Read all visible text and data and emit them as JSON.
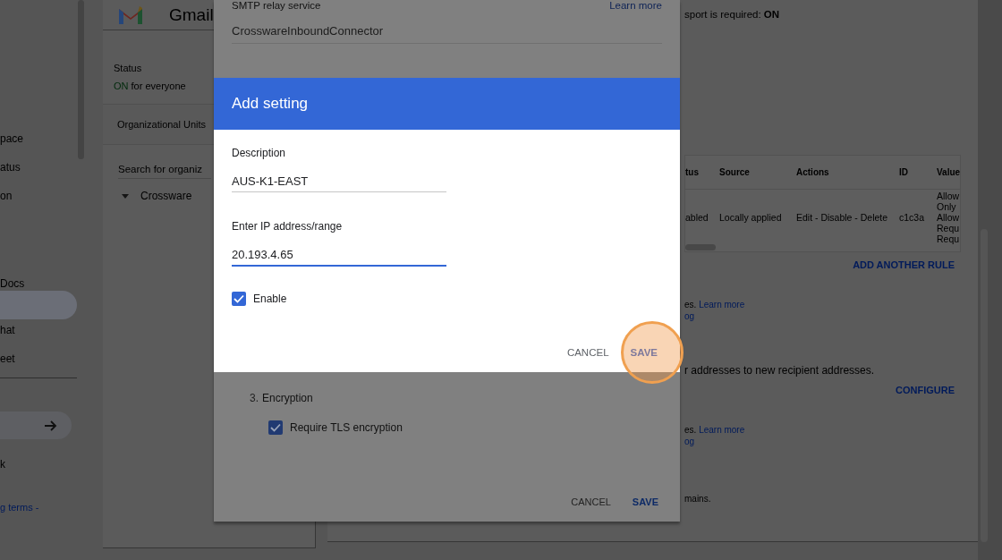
{
  "sidebar": {
    "groups": [
      {
        "items": [
          {
            "label": "pace",
            "selected": false
          },
          {
            "label": "atus",
            "selected": false
          },
          {
            "label": "on",
            "selected": false
          }
        ]
      },
      {
        "items": [
          {
            "label": "Docs",
            "selected": false
          },
          {
            "selected": true
          },
          {
            "label": "hat",
            "selected": false
          },
          {
            "label": "eet",
            "selected": false
          }
        ]
      }
    ],
    "after_divider": {
      "label": "k"
    },
    "footer_link": "g terms -"
  },
  "app_card": {
    "title": "Gmail",
    "status_label": "Status",
    "status_value": "ON",
    "status_text": "for everyone",
    "org_units_heading": "Organizational Units",
    "search": {
      "placeholder": "Search for organiz"
    },
    "tree": [
      {
        "label": "Crossware",
        "expanded": true
      }
    ]
  },
  "settings_panel": {
    "top_text": "sport is required: **ON**",
    "table": {
      "columns": [
        "tus",
        "Source",
        "Actions",
        "ID",
        "Value"
      ],
      "rows": [
        {
          "status": "abled",
          "source": "Locally applied",
          "actions": "Edit - Disable - Delete",
          "id": "c1c3a",
          "value_lines": [
            "Allow",
            "Only",
            "Allow",
            "Requ",
            "Requ"
          ]
        }
      ]
    },
    "add_rule_button": "ADD ANOTHER RULE",
    "sections": [
      {
        "kind": "note",
        "text": "es.",
        "link": "Learn more",
        "link_2": "og"
      },
      {
        "kind": "action",
        "text": "r addresses to new recipient addresses.",
        "button": "CONFIGURE"
      },
      {
        "kind": "note",
        "text": "es.",
        "link": "Learn more",
        "link_2": "og"
      },
      {
        "kind": "plain",
        "text": "mains."
      }
    ]
  },
  "relay_dialog": {
    "service_label": "SMTP relay service",
    "learn_more": "Learn more",
    "name_value": "CrosswareInboundConnector",
    "encryption": {
      "number": "3.",
      "title": "Encryption",
      "options": [
        {
          "label": "Require TLS encryption",
          "checked": true
        }
      ]
    },
    "buttons": [
      {
        "label": "CANCEL",
        "primary": false
      },
      {
        "label": "SAVE",
        "primary": true
      }
    ]
  },
  "add_setting_dialog": {
    "title": "Add setting",
    "fields": [
      {
        "label": "Description",
        "value": "AUS-K1-EAST",
        "focused": false
      },
      {
        "label": "Enter IP address/range",
        "value": "20.193.4.65",
        "focused": true
      }
    ],
    "enable": {
      "label": "Enable",
      "checked": true
    },
    "buttons": [
      {
        "label": "CANCEL",
        "primary": false
      },
      {
        "label": "SAVE",
        "primary": true
      }
    ]
  }
}
